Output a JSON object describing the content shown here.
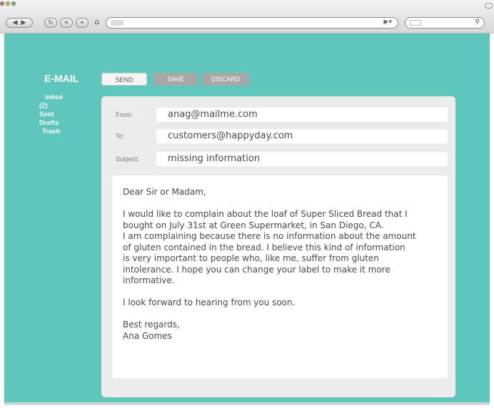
{
  "app": {
    "title": "E-MAIL"
  },
  "sidebar": {
    "items": [
      {
        "label": "Inbox"
      },
      {
        "label": "(2)"
      },
      {
        "label": "Sent"
      },
      {
        "label": "Drafts"
      },
      {
        "label": "Trash"
      }
    ]
  },
  "toolbar": {
    "send_label": "SEND",
    "save_label": "SAVE",
    "discard_label": "DISCARD"
  },
  "compose": {
    "from_label": "From:",
    "from_value": "anag@mailme.com",
    "to_label": "To:",
    "to_value": "customers@happyday.com",
    "subject_label": "Subject:",
    "subject_value": "missing information",
    "body": {
      "greeting": "Dear Sir or Madam,",
      "paragraph1_lines": [
        "I would like to complain about the loaf of Super Sliced Bread that I",
        "bought on July 31st at Green Supermarket, in San Diego, CA.",
        "I am complaining because there is no information about the amount",
        "of gluten contained in the bread. I believe this kind of information",
        "is very important to people who, like me, suffer from gluten",
        "intolerance. I hope you can change your label to make it more",
        "informative."
      ],
      "closing_line": "I look forward to hearing from you soon.",
      "sign_off": "Best regards,",
      "signature": "Ana Gomes"
    }
  },
  "browser": {
    "icons": [
      "back-icon",
      "forward-icon",
      "home-icon",
      "rss-icon",
      "search-icon"
    ],
    "colors": {
      "content_background": "#5ec6bd",
      "panel_background": "#ececec",
      "button_gray": "#a8a8a8"
    }
  }
}
